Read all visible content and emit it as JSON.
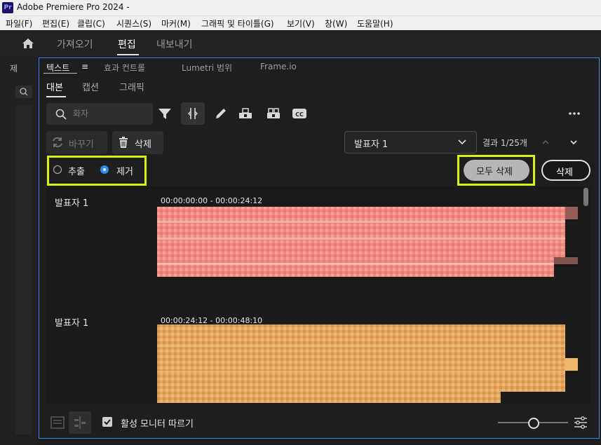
{
  "window": {
    "title": "Adobe Premiere Pro 2024 -",
    "app_icon_text": "Pr"
  },
  "menu": [
    "파일(F)",
    "편집(E)",
    "클립(C)",
    "시퀀스(S)",
    "마커(M)",
    "그래픽 및 타이틀(G)",
    "보기(V)",
    "창(W)",
    "도움말(H)"
  ],
  "workspace_tabs": [
    {
      "label": "가져오기",
      "active": false
    },
    {
      "label": "편집",
      "active": true
    },
    {
      "label": "내보내기",
      "active": false
    }
  ],
  "left_panel": {
    "label": "제"
  },
  "panel_tabs": [
    {
      "label": "텍스트",
      "active": true,
      "menu_glyph": "≡"
    },
    {
      "label": "효과 컨트롤",
      "active": false
    },
    {
      "label": "Lumetri 범위",
      "active": false
    },
    {
      "label": "Frame.io",
      "active": false
    }
  ],
  "sub_tabs": [
    {
      "label": "대본",
      "active": true
    },
    {
      "label": "캡션",
      "active": false
    },
    {
      "label": "그래픽",
      "active": false
    }
  ],
  "search": {
    "placeholder": "화자",
    "value": ""
  },
  "toolbar_icons": [
    "filter-icon",
    "split-icon",
    "pen-icon",
    "merge-clip-icon",
    "split-clip-icon",
    "cc-icon",
    "more-icon"
  ],
  "actions": {
    "replace_label": "바꾸기",
    "delete_label": "삭제",
    "speaker_selected": "발표자 1",
    "results": "결과 1/25개"
  },
  "mode": {
    "extract_label": "추출",
    "remove_label": "제거",
    "selected": "제거"
  },
  "delete_all_label": "모두 삭제",
  "delete_label_2": "삭제",
  "transcript": [
    {
      "speaker": "발표자 1",
      "timecode": "00:00:00:00 - 00:00:24:12"
    },
    {
      "speaker": "발표자 1",
      "timecode": "00:00:24:12 - 00:00:48:10"
    }
  ],
  "footer": {
    "follow_label": "활성 모니터 따르기",
    "follow_checked": true
  },
  "colors": {
    "highlight": "#d7f30f",
    "selection_blue": "#2d8ceb",
    "blur_pink": "#f08a80",
    "blur_orange": "#e1a560"
  }
}
